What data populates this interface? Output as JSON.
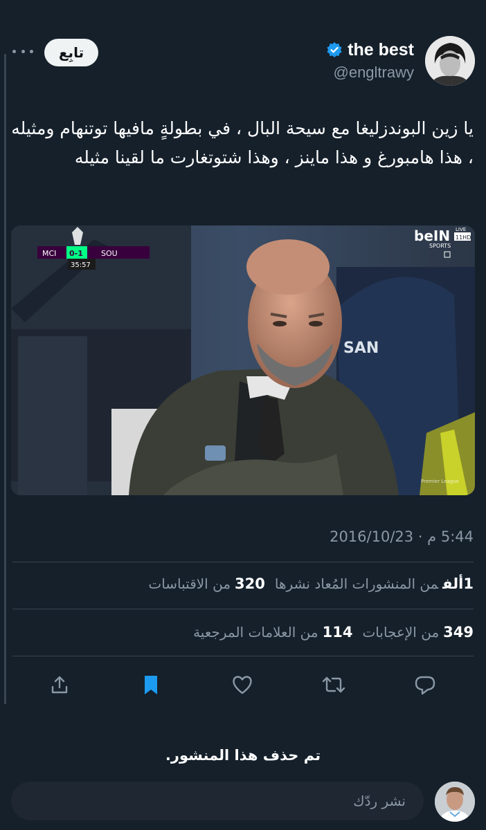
{
  "author": {
    "display_name": "the best",
    "handle": "@engltrawy"
  },
  "follow_label": "تابِع",
  "tweet": {
    "text": "يا زين البوندزليغا مع سيحة البال ، في بطولةٍ مافيها توتنهام ومثيله ، هذا هامبورغ و هذا ماينز ، وهذا شتوتغارت ما لقينا مثيله",
    "timestamp": "5:44 م · 2016/10/23"
  },
  "media": {
    "scoreboard": {
      "home": "MCI",
      "away": "SOU",
      "score": "0-1",
      "clock": "35:57"
    },
    "broadcaster": "beIN",
    "broadcaster_sub": "SPORTS",
    "channel": "11HD",
    "live": "LIVE",
    "banner_text": "SAN",
    "watermark": "Premier League"
  },
  "stats": {
    "retweets_value": "1ألف",
    "retweets_label": "من المنشورات المُعاد نشرها",
    "quotes_value": "320",
    "quotes_label": "من الاقتباسات",
    "likes_value": "349",
    "likes_label": "من الإعجابات",
    "bookmarks_value": "114",
    "bookmarks_label": "من العلامات المرجعية"
  },
  "deleted_notice": "تم حذف هذا المنشور.",
  "reply": {
    "placeholder": "نشر ردّك"
  },
  "icons": {
    "verified": "verified-badge-icon",
    "share": "share-icon",
    "bookmark": "bookmark-icon",
    "like": "heart-icon",
    "retweet": "retweet-icon",
    "reply": "reply-icon"
  },
  "colors": {
    "background": "#15202b",
    "accent": "#1d9bf0",
    "muted_text": "#8b98a5",
    "divider": "#38444d"
  }
}
